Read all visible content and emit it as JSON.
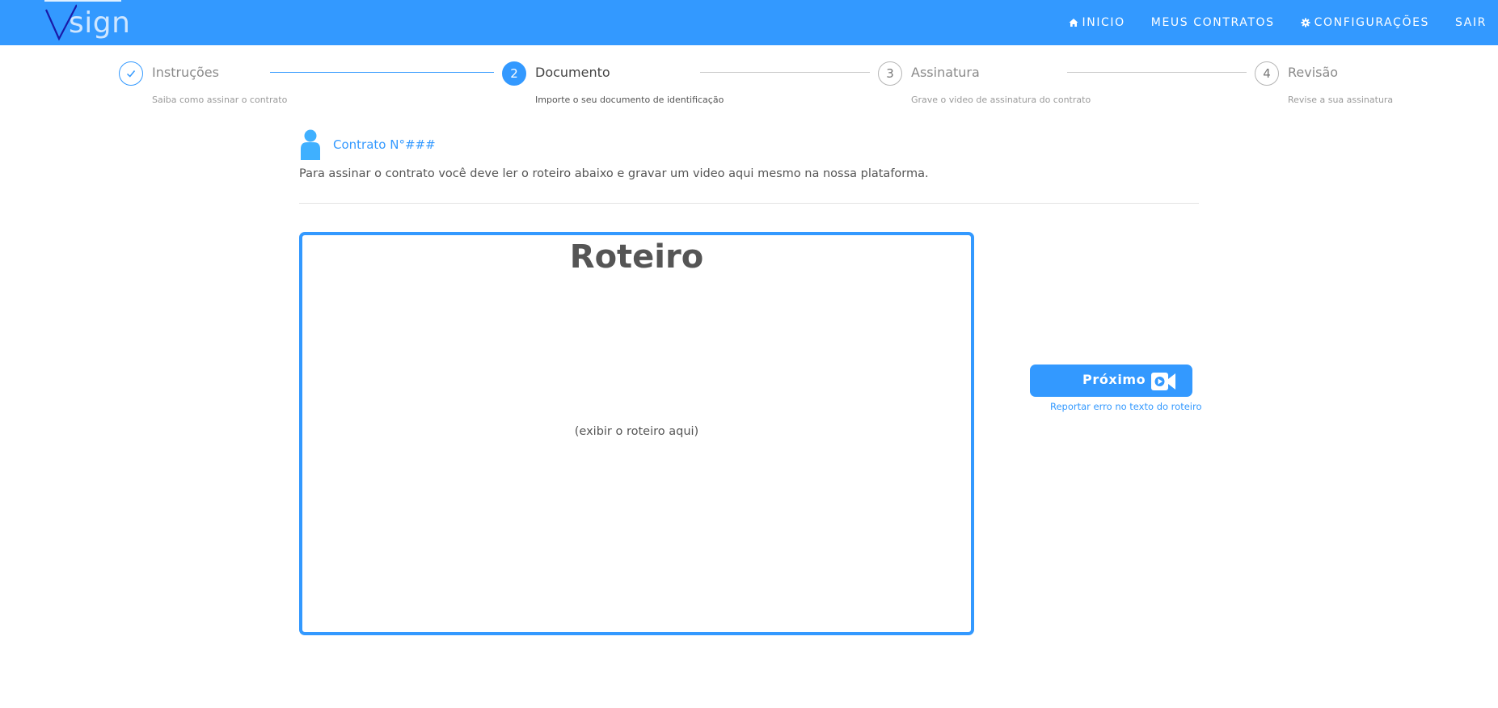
{
  "brand": {
    "logo_text": "sign",
    "logo_initial": "V"
  },
  "nav": {
    "items": [
      {
        "label": "INICIO",
        "icon": "home-icon"
      },
      {
        "label": "MEUS CONTRATOS",
        "icon": ""
      },
      {
        "label": "CONFIGURAÇÕES",
        "icon": "gear-icon"
      },
      {
        "label": "SAIR",
        "icon": ""
      }
    ]
  },
  "stepper": {
    "steps": [
      {
        "number": "",
        "state": "done",
        "title": "Instruções",
        "subtitle": "Saiba como assinar o contrato",
        "icon": "check-icon"
      },
      {
        "number": "2",
        "state": "active",
        "title": "Documento",
        "subtitle": "Importe o seu documento de identificação"
      },
      {
        "number": "3",
        "state": "pending",
        "title": "Assinatura",
        "subtitle": "Grave o video de assinatura do contrato"
      },
      {
        "number": "4",
        "state": "pending",
        "title": "Revisão",
        "subtitle": "Revise a sua assinatura"
      }
    ]
  },
  "contract": {
    "title": "Contrato N°###",
    "intro": "Para assinar o contrato você deve ler o roteiro abaixo e gravar um video aqui mesmo na nossa plataforma."
  },
  "script": {
    "title": "Roteiro",
    "placeholder": "(exibir o roteiro aqui)"
  },
  "actions": {
    "next_label": "Próximo",
    "next_icon": "video-camera-icon",
    "report_link": "Reportar erro no texto do roteiro"
  },
  "colors": {
    "primary": "#3399ff",
    "text": "#555555",
    "muted": "#9a9a9a"
  }
}
